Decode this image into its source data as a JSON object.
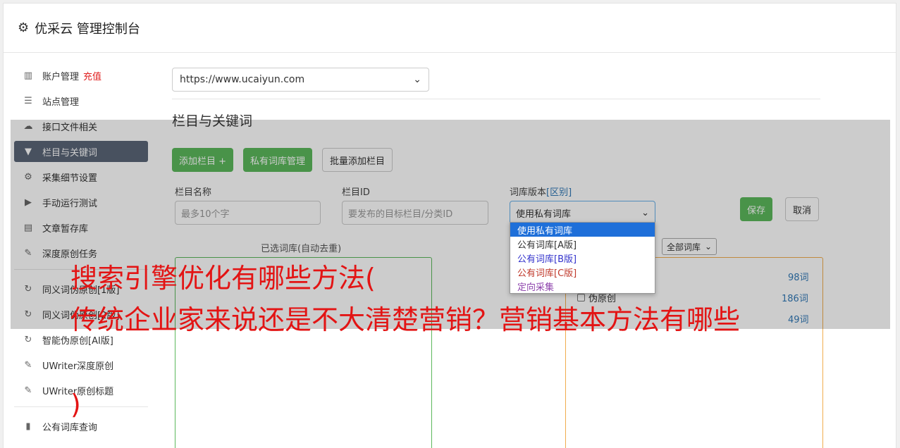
{
  "header": {
    "title": "优采云 管理控制台",
    "icon": "gear-icon"
  },
  "sidebar": {
    "items": [
      {
        "label": "账户管理",
        "icon": "bar-chart-icon",
        "badge": "充值"
      },
      {
        "label": "站点管理",
        "icon": "server-icon"
      },
      {
        "label": "接口文件相关",
        "icon": "cloud-upload-icon"
      },
      {
        "label": "栏目与关键词",
        "icon": "filter-icon",
        "active": true
      },
      {
        "label": "采集细节设置",
        "icon": "cogs-icon"
      },
      {
        "label": "手动运行测试",
        "icon": "play-circle-icon"
      },
      {
        "label": "文章暂存库",
        "icon": "database-icon"
      },
      {
        "label": "深度原创任务",
        "icon": "edit-icon"
      },
      {
        "label": "同义词伪原创[1版]",
        "icon": "refresh-icon"
      },
      {
        "label": "同义词伪原创[2版]",
        "icon": "refresh-icon"
      },
      {
        "label": "智能伪原创[AI版]",
        "icon": "refresh-icon"
      },
      {
        "label": "UWriter深度原创",
        "icon": "edit-icon"
      },
      {
        "label": "UWriter原创标题",
        "icon": "edit-icon"
      },
      {
        "label": "公有词库查询",
        "icon": "book-icon"
      }
    ]
  },
  "main": {
    "site_select": "https://www.ucaiyun.com",
    "section_title": "栏目与关键词",
    "buttons": {
      "add_column": "添加栏目 +",
      "private_lib": "私有词库管理",
      "batch_add": "批量添加栏目"
    },
    "fields": {
      "name_label": "栏目名称",
      "name_placeholder": "最多10个字",
      "id_label": "栏目ID",
      "id_placeholder": "要发布的目标栏目/分类ID",
      "version_label": "词库版本",
      "version_link": "[区别]",
      "version_value": "使用私有词库"
    },
    "save": "保存",
    "cancel": "取消",
    "dropdown_options": [
      {
        "label": "使用私有词库",
        "color": "#ffffff"
      },
      {
        "label": "公有词库[A版]",
        "color": "#333333"
      },
      {
        "label": "公有词库[B版]",
        "color": "#3333cc"
      },
      {
        "label": "公有词库[C版]",
        "color": "#c0392b"
      },
      {
        "label": "定向采集",
        "color": "#8e44ad"
      }
    ],
    "selected_libs_label": "已选词库(自动去重)",
    "all_libs_select": "全部词库",
    "libs": [
      {
        "label": "",
        "count": "98词"
      },
      {
        "label": "伪原创",
        "count": "186词"
      },
      {
        "label": "",
        "count": "49词"
      }
    ]
  },
  "overlay_text": {
    "line1": "搜索引擎优化有哪些方法(",
    "line2": "传统企业家来说还是不大清楚营销？营销基本方法有哪些",
    "line3": ")"
  }
}
